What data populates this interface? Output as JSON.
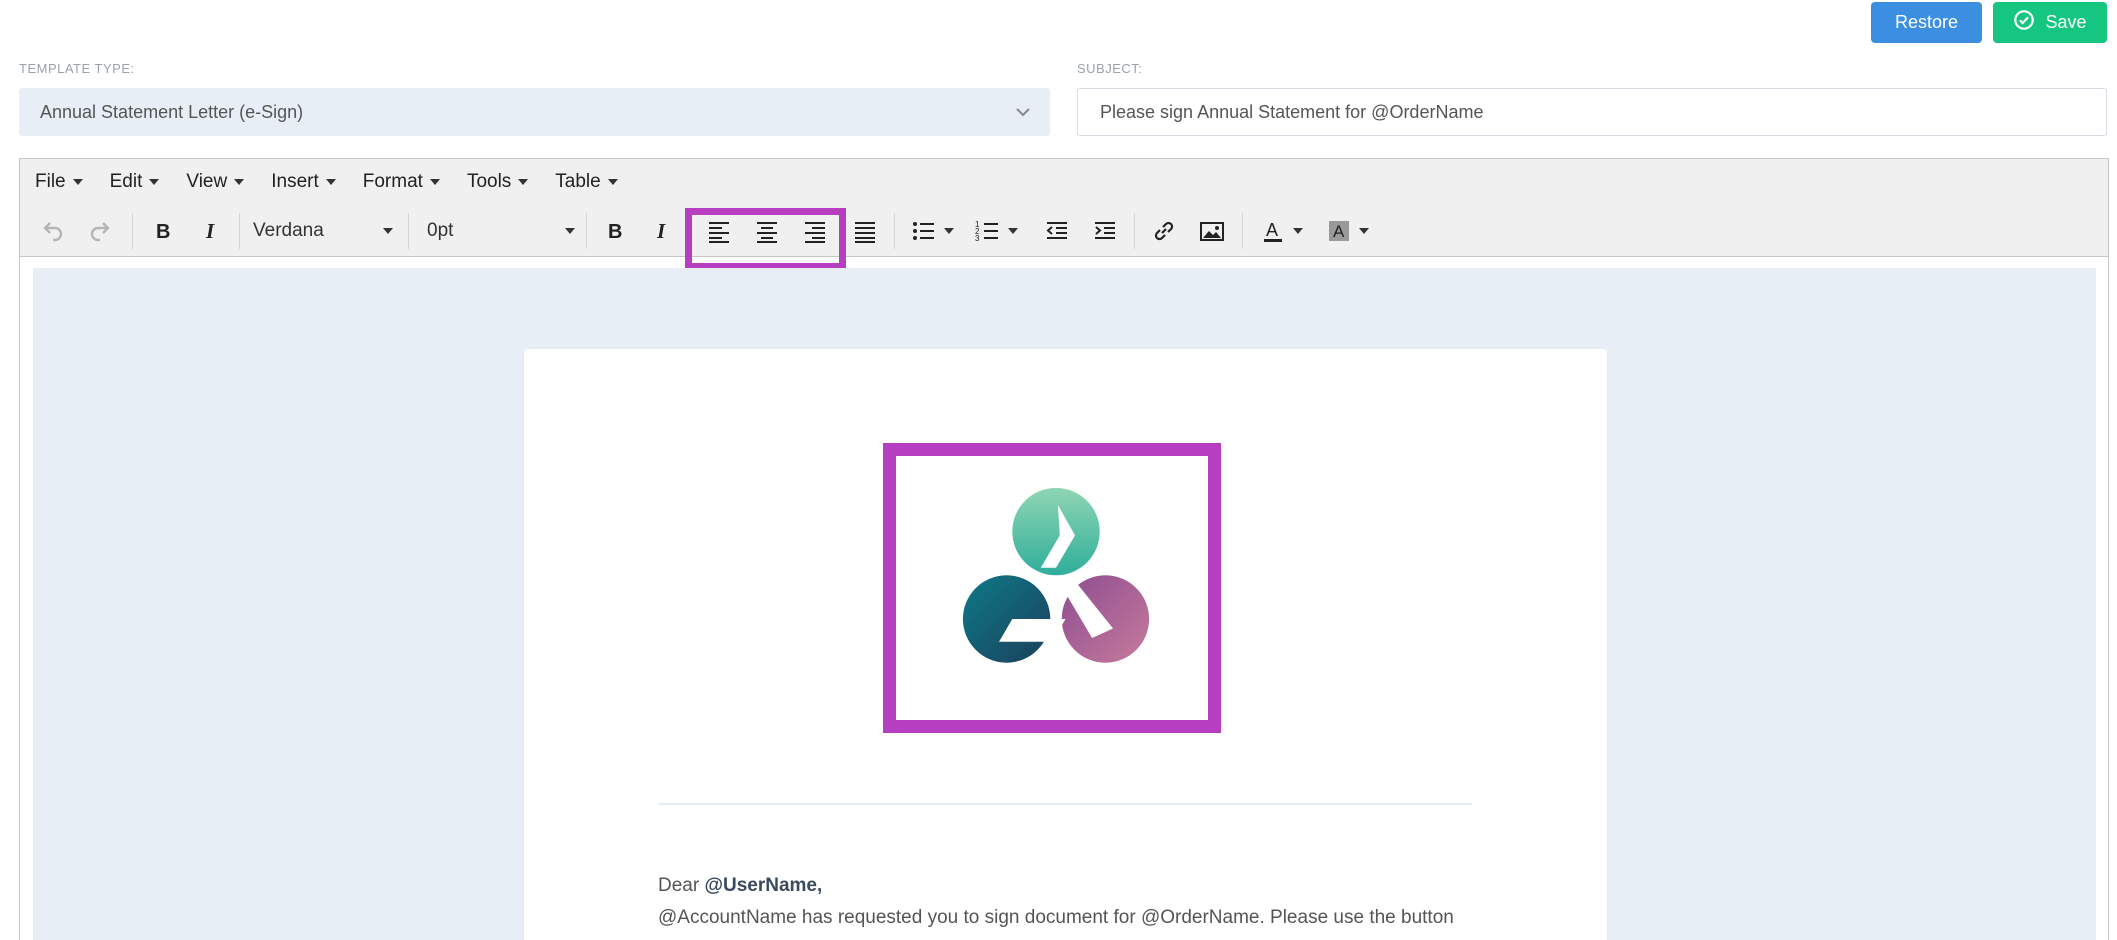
{
  "header": {
    "restore_label": "Restore",
    "save_label": "Save"
  },
  "fields": {
    "template_type_label": "TEMPLATE TYPE:",
    "template_type_value": "Annual Statement Letter (e-Sign)",
    "subject_label": "SUBJECT:",
    "subject_value": "Please sign Annual Statement for @OrderName"
  },
  "menubar": {
    "items": [
      {
        "label": "File"
      },
      {
        "label": "Edit"
      },
      {
        "label": "View"
      },
      {
        "label": "Insert"
      },
      {
        "label": "Format"
      },
      {
        "label": "Tools"
      },
      {
        "label": "Table"
      }
    ]
  },
  "toolbar": {
    "font_family": "Verdana",
    "font_size": "0pt"
  },
  "document": {
    "greeting_prefix": "Dear",
    "greeting_name": "@UserName,",
    "body_line": "@AccountName has requested you to sign document for @OrderName. Please use the button"
  },
  "colors": {
    "restore": "#3c8fe0",
    "save": "#14c67f",
    "highlight": "#b63fc1"
  },
  "icons": [
    "undo-icon",
    "redo-icon",
    "bold-icon",
    "italic-icon",
    "align-left-icon",
    "align-center-icon",
    "align-right-icon",
    "justify-icon",
    "bullet-list-icon",
    "numbered-list-icon",
    "outdent-icon",
    "indent-icon",
    "link-icon",
    "image-icon",
    "text-color-icon",
    "background-color-icon",
    "chevron-down-icon",
    "check-circle-icon"
  ]
}
